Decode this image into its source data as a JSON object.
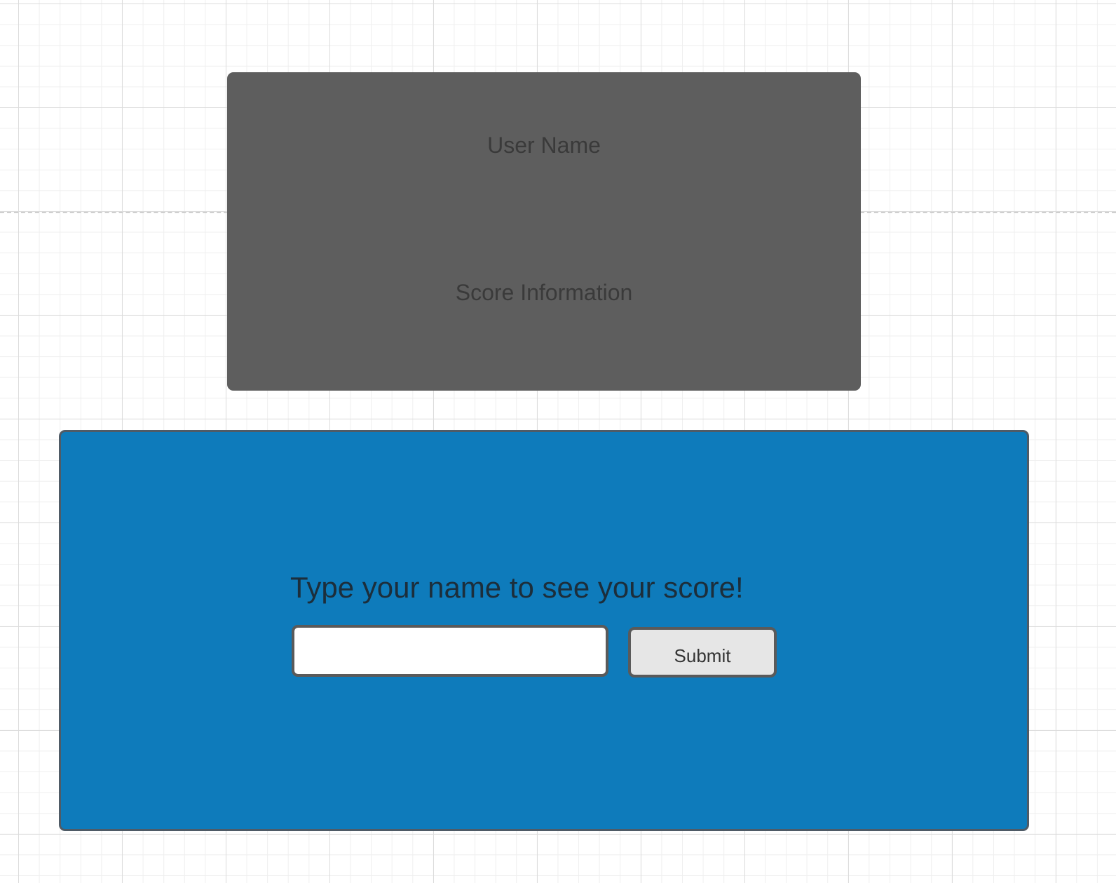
{
  "score_card": {
    "user_name_label": "User Name",
    "score_info_label": "Score Information"
  },
  "input_panel": {
    "prompt": "Type your name to see your score!",
    "name_input_value": "",
    "name_input_placeholder": "",
    "submit_label": "Submit"
  },
  "colors": {
    "score_card_bg": "#5e5e5e",
    "panel_bg": "#0e7bbb",
    "button_bg": "#e6e6e6"
  }
}
